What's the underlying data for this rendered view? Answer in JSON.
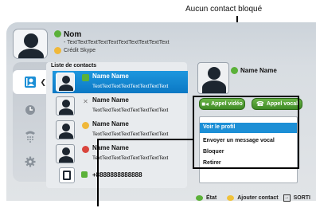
{
  "callout": "Aucun contact bloqué",
  "user": {
    "name": "Nom",
    "status_message": "- TextTextTextTextTextTextTextTextTextText",
    "credit": "Crédit Skype"
  },
  "contacts_title": "Liste de contacts",
  "contacts": [
    {
      "name": "Name Name",
      "message": "TextTextTextTextTextTextTextText",
      "status": "online",
      "selected": true
    },
    {
      "name": "Name Name",
      "message": "TextTextTextTextTextTextTextText",
      "status": "offline",
      "selected": false
    },
    {
      "name": "Name Name",
      "message": "TextTextTextTextTextTextTextText",
      "status": "away",
      "selected": false
    },
    {
      "name": "Name Name",
      "message": "TextTextTextTextTextTextTextText",
      "status": "busy",
      "selected": false
    }
  ],
  "phone_number": "+8888888888888",
  "detail": {
    "name": "Name Name",
    "video_call": "Appel vidéo",
    "voice_call": "Appel vocal"
  },
  "menu": [
    "Voir le profil",
    "Envoyer un message vocal",
    "Bloquer",
    "Retirer"
  ],
  "footer": {
    "state": "État",
    "add_contact": "Ajouter contact",
    "exit": "SORTI"
  },
  "colors": {
    "accent_blue": "#1c8fd6",
    "call_green": "#4f9e31",
    "online": "#5bb139",
    "away": "#f0b83a",
    "busy": "#d9453d"
  }
}
